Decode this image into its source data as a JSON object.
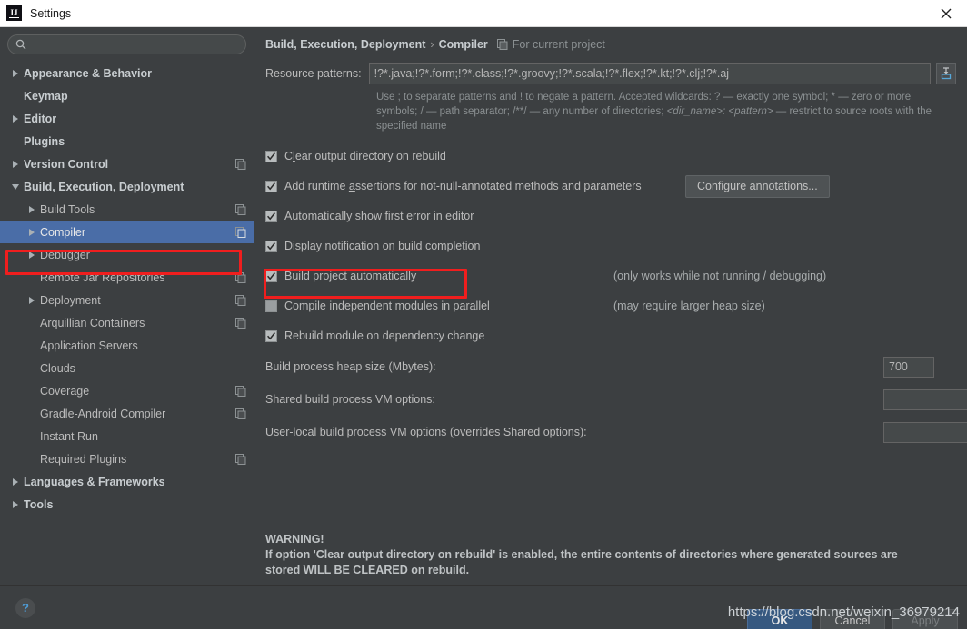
{
  "window": {
    "title": "Settings",
    "logo_text": "IJ",
    "logo_icon": "intellij-logo-icon",
    "close_icon": "close-icon"
  },
  "sidebar": {
    "search": {
      "value": "",
      "placeholder": "",
      "icon": "search-icon"
    },
    "items": [
      {
        "label": "Appearance & Behavior",
        "arrow": "right",
        "indent": 0,
        "bold": true,
        "module_icon": false,
        "selected": false
      },
      {
        "label": "Keymap",
        "arrow": "none",
        "indent": 0,
        "bold": true,
        "module_icon": false,
        "selected": false
      },
      {
        "label": "Editor",
        "arrow": "right",
        "indent": 0,
        "bold": true,
        "module_icon": false,
        "selected": false
      },
      {
        "label": "Plugins",
        "arrow": "none",
        "indent": 0,
        "bold": true,
        "module_icon": false,
        "selected": false
      },
      {
        "label": "Version Control",
        "arrow": "right",
        "indent": 0,
        "bold": true,
        "module_icon": true,
        "selected": false
      },
      {
        "label": "Build, Execution, Deployment",
        "arrow": "down",
        "indent": 0,
        "bold": true,
        "module_icon": false,
        "selected": false
      },
      {
        "label": "Build Tools",
        "arrow": "right",
        "indent": 1,
        "bold": false,
        "module_icon": true,
        "selected": false
      },
      {
        "label": "Compiler",
        "arrow": "right",
        "indent": 1,
        "bold": false,
        "module_icon": true,
        "selected": true
      },
      {
        "label": "Debugger",
        "arrow": "right",
        "indent": 1,
        "bold": false,
        "module_icon": false,
        "selected": false
      },
      {
        "label": "Remote Jar Repositories",
        "arrow": "none",
        "indent": 1,
        "bold": false,
        "module_icon": true,
        "selected": false
      },
      {
        "label": "Deployment",
        "arrow": "right",
        "indent": 1,
        "bold": false,
        "module_icon": true,
        "selected": false
      },
      {
        "label": "Arquillian Containers",
        "arrow": "none",
        "indent": 1,
        "bold": false,
        "module_icon": true,
        "selected": false
      },
      {
        "label": "Application Servers",
        "arrow": "none",
        "indent": 1,
        "bold": false,
        "module_icon": false,
        "selected": false
      },
      {
        "label": "Clouds",
        "arrow": "none",
        "indent": 1,
        "bold": false,
        "module_icon": false,
        "selected": false
      },
      {
        "label": "Coverage",
        "arrow": "none",
        "indent": 1,
        "bold": false,
        "module_icon": true,
        "selected": false
      },
      {
        "label": "Gradle-Android Compiler",
        "arrow": "none",
        "indent": 1,
        "bold": false,
        "module_icon": true,
        "selected": false
      },
      {
        "label": "Instant Run",
        "arrow": "none",
        "indent": 1,
        "bold": false,
        "module_icon": false,
        "selected": false
      },
      {
        "label": "Required Plugins",
        "arrow": "none",
        "indent": 1,
        "bold": false,
        "module_icon": true,
        "selected": false
      },
      {
        "label": "Languages & Frameworks",
        "arrow": "right",
        "indent": 0,
        "bold": true,
        "module_icon": false,
        "selected": false
      },
      {
        "label": "Tools",
        "arrow": "right",
        "indent": 0,
        "bold": true,
        "module_icon": false,
        "selected": false
      }
    ]
  },
  "main": {
    "breadcrumb": {
      "parent": "Build, Execution, Deployment",
      "separator": "›",
      "current": "Compiler",
      "scope": "For current project",
      "scope_icon": "module-icon"
    },
    "resource_patterns": {
      "label": "Resource patterns:",
      "value": "!?*.java;!?*.form;!?*.class;!?*.groovy;!?*.scala;!?*.flex;!?*.kt;!?*.clj;!?*.aj",
      "placeholder": "",
      "expand_button_icon": "insert-into-field-icon"
    },
    "hint_line1": "Use ; to separate patterns and ! to negate a pattern. Accepted wildcards: ? — exactly one symbol; * — zero or more",
    "hint_line2_a": "symbols; / — path separator; /**/ — any number of directories;  ",
    "hint_line2_italic": "<dir_name>: <pattern>",
    "hint_line2_b": " — restrict to source roots with",
    "hint_line3": "the specified name",
    "checkboxes": [
      {
        "label_pre": "C",
        "mnemonic": "l",
        "label_post": "ear output directory on rebuild",
        "checked": true,
        "note": "",
        "button": ""
      },
      {
        "label_pre": "Add runtime ",
        "mnemonic": "a",
        "label_post": "ssertions for not-null-annotated methods and parameters",
        "checked": true,
        "note": "",
        "button": "Configure annotations..."
      },
      {
        "label_pre": "Automatically show first ",
        "mnemonic": "e",
        "label_post": "rror in editor",
        "checked": true,
        "note": "",
        "button": ""
      },
      {
        "label_pre": "Display notification on build completion",
        "mnemonic": "",
        "label_post": "",
        "checked": true,
        "note": "",
        "button": ""
      },
      {
        "label_pre": "Build project automatically",
        "mnemonic": "",
        "label_post": "",
        "checked": true,
        "note": "(only works while not running / debugging)",
        "button": ""
      },
      {
        "label_pre": "Compile independent modules in parallel",
        "mnemonic": "",
        "label_post": "",
        "checked": false,
        "note": "(may require larger heap size)",
        "button": ""
      },
      {
        "label_pre": "Rebuild module on dependency change",
        "mnemonic": "",
        "label_post": "",
        "checked": true,
        "note": "",
        "button": ""
      }
    ],
    "fields": [
      {
        "label": "Build process heap size (Mbytes):",
        "value": "700",
        "width": "narrow"
      },
      {
        "label": "Shared build process VM options:",
        "value": "",
        "width": "wide"
      },
      {
        "label": "User-local build process VM options (overrides Shared options):",
        "value": "",
        "width": "wide"
      }
    ],
    "warning_title": "WARNING!",
    "warning_body_1": "If option 'Clear output directory on rebuild' is enabled, the entire contents of directories where generated sources are",
    "warning_body_2": "stored WILL BE CLEARED on rebuild."
  },
  "footer": {
    "help_icon": "help-question-icon",
    "help_label": "?",
    "ok_label": "OK",
    "cancel_label": "Cancel",
    "apply_label": "Apply"
  },
  "watermark": "https://blog.csdn.net/weixin_36979214",
  "colors": {
    "accent_selection": "#4a6da7",
    "annotation_red": "#f01e1e",
    "primary_button": "#365880",
    "panel_bg": "#3c3f41",
    "field_bg": "#45494a"
  }
}
